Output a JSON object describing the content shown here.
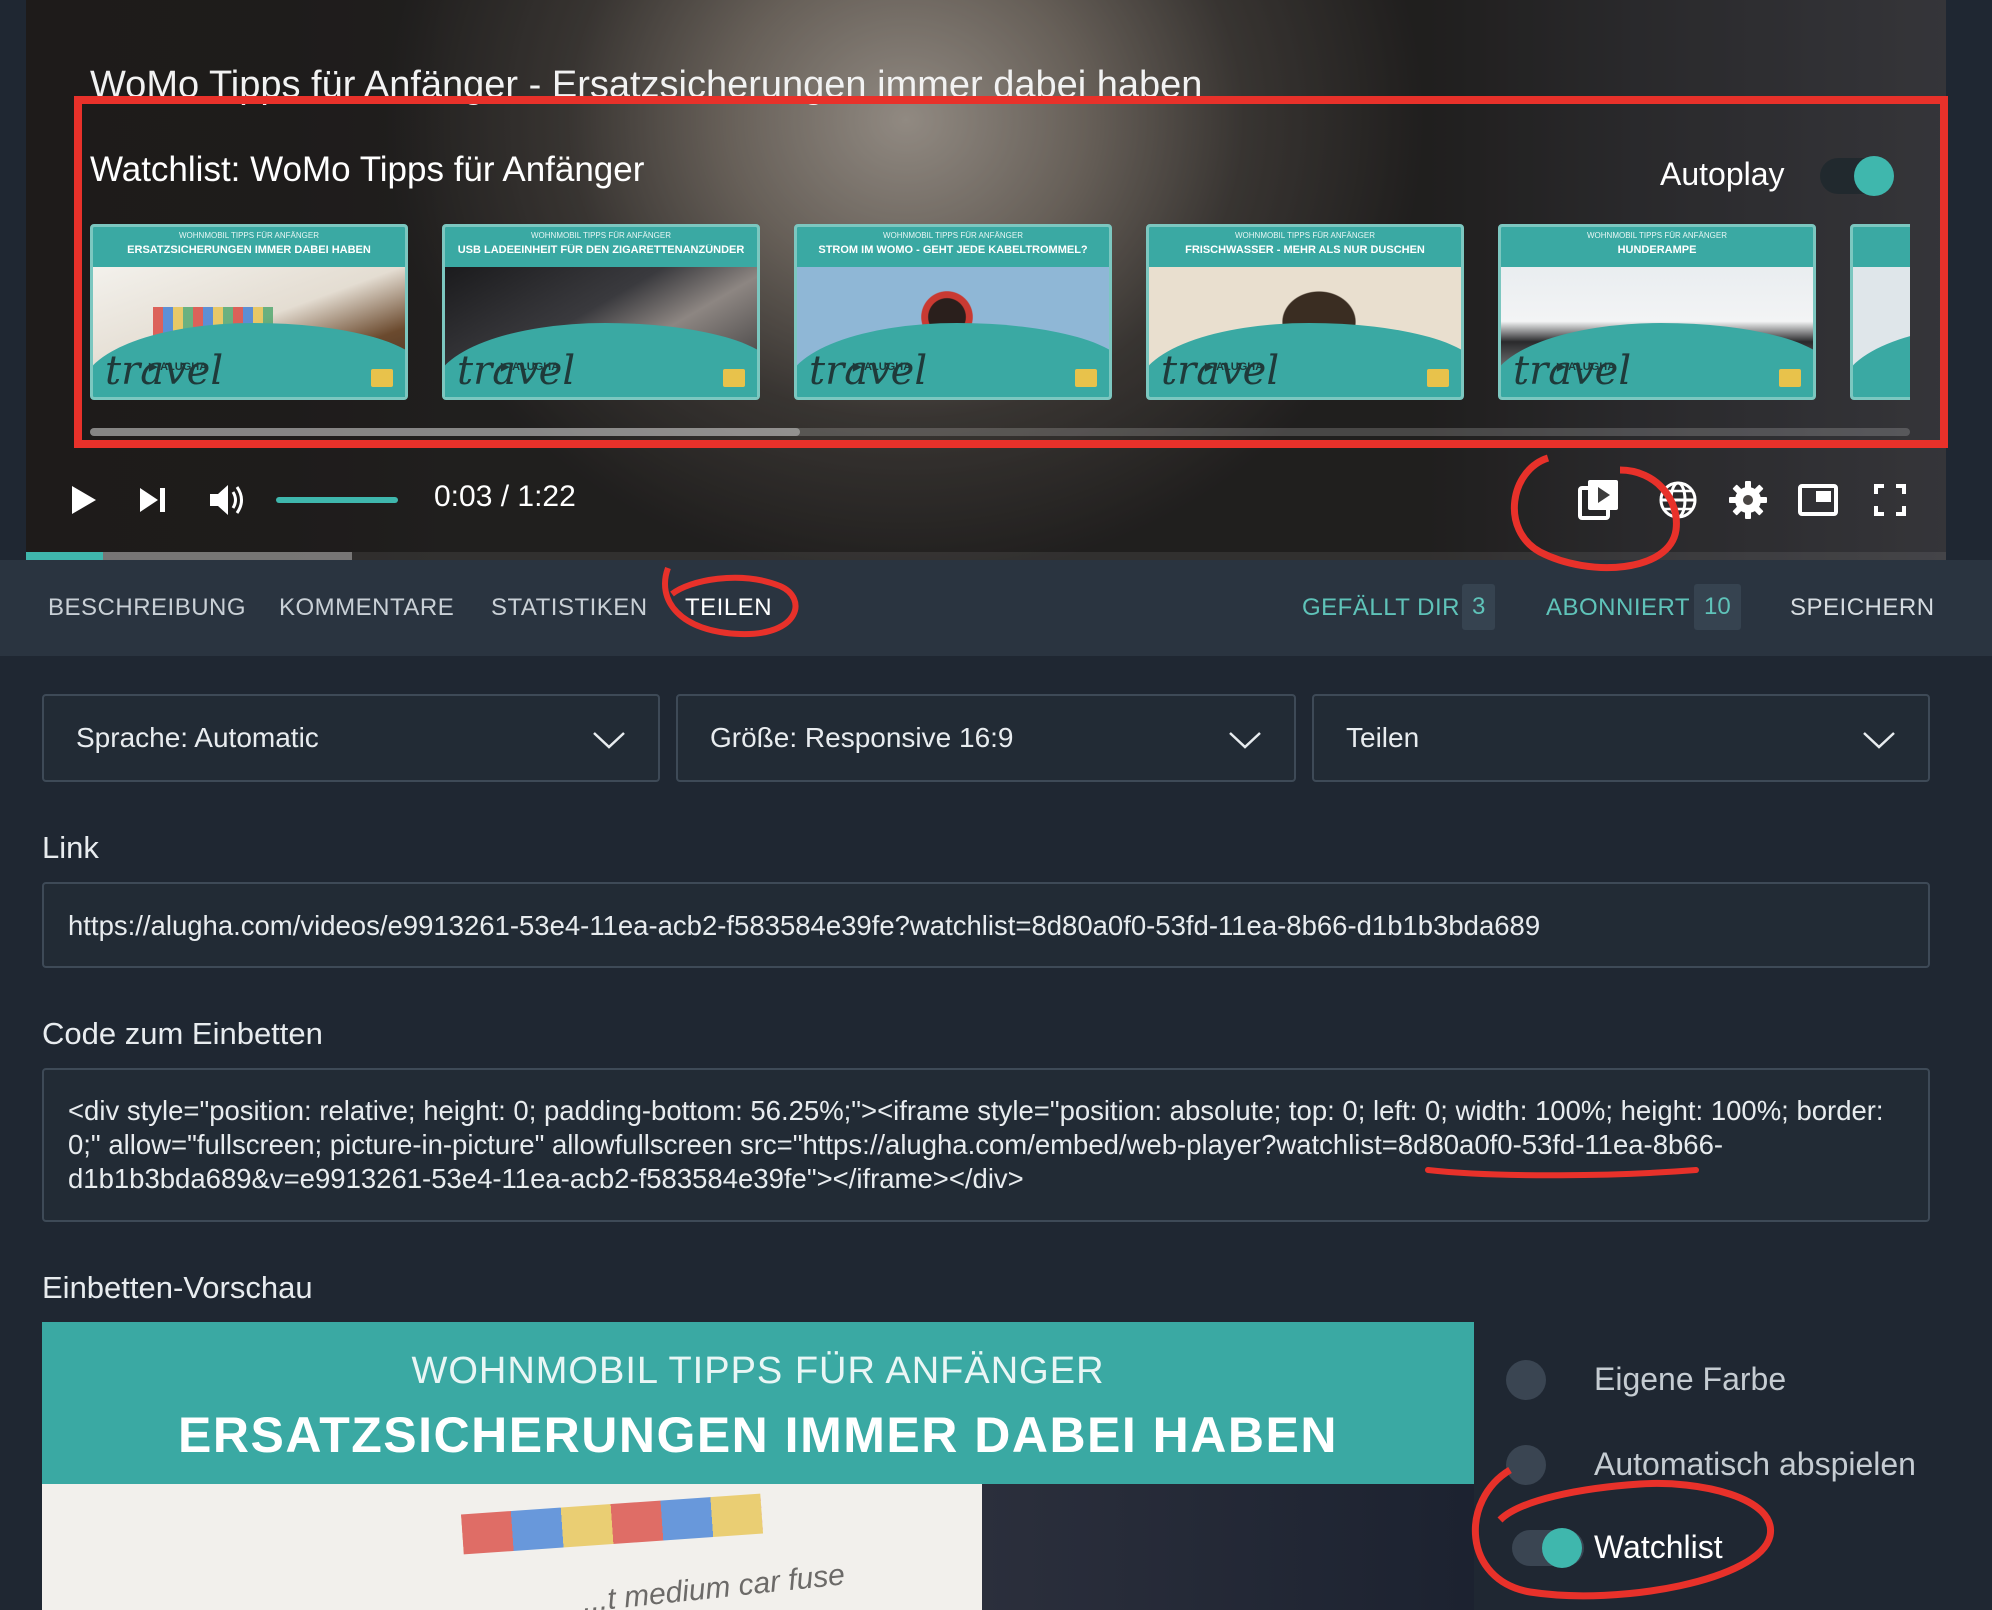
{
  "player": {
    "video_title": "WoMo Tipps für Anfänger - Ersatzsicherungen immer dabei haben",
    "watchlist_title": "Watchlist: WoMo Tipps für Anfänger",
    "autoplay_label": "Autoplay",
    "autoplay_on": true,
    "thumbnails": [
      {
        "sup": "WOHNMOBIL TIPPS FÜR ANFÄNGER",
        "caption": "ERSATZSICHERUNGEN IMMER DABEI HABEN",
        "brand": "travel",
        "brand_sup": "▶ ALUGHA"
      },
      {
        "sup": "WOHNMOBIL TIPPS FÜR ANFÄNGER",
        "caption": "USB LADEEINHEIT FÜR DEN ZIGARETTENANZÜNDER",
        "brand": "travel",
        "brand_sup": "▶ ALUGHA"
      },
      {
        "sup": "WOHNMOBIL TIPPS FÜR ANFÄNGER",
        "caption": "STROM IM WOMO - GEHT JEDE KABELTROMMEL?",
        "brand": "travel",
        "brand_sup": "▶ ALUGHA"
      },
      {
        "sup": "WOHNMOBIL TIPPS FÜR ANFÄNGER",
        "caption": "FRISCHWASSER - MEHR ALS NUR DUSCHEN",
        "brand": "travel",
        "brand_sup": "▶ ALUGHA"
      },
      {
        "sup": "WOHNMOBIL TIPPS FÜR ANFÄNGER",
        "caption": "HUNDERAMPE",
        "brand": "travel",
        "brand_sup": "▶ ALUGHA"
      }
    ],
    "time_display": "0:03 / 1:22",
    "current_time": "0:03",
    "duration": "1:22",
    "playback_progress": 0.04,
    "buffered_progress": 0.17,
    "watchlist_scroll_progress": 0.39,
    "volume_level": 1.0,
    "icons": [
      "play-icon",
      "skip-next-icon",
      "volume-icon",
      "watchlist-icon",
      "language-globe-icon",
      "settings-gear-icon",
      "miniplayer-icon",
      "fullscreen-icon"
    ]
  },
  "tabs": [
    {
      "label": "BESCHREIBUNG",
      "active": false
    },
    {
      "label": "KOMMENTARE",
      "active": false
    },
    {
      "label": "STATISTIKEN",
      "active": false
    },
    {
      "label": "TEILEN",
      "active": true
    }
  ],
  "actions": {
    "like_label": "GEFÄLLT DIR",
    "like_count": "3",
    "subscribe_label": "ABONNIERT",
    "subscribe_count": "10",
    "save_label": "SPEICHERN"
  },
  "share": {
    "language_select": "Sprache: Automatic",
    "size_select": "Größe: Responsive 16:9",
    "share_select": "Teilen",
    "link_label": "Link",
    "link_value": "https://alugha.com/videos/e9913261-53e4-11ea-acb2-f583584e39fe?watchlist=8d80a0f0-53fd-11ea-8b66-d1b1b3bda689",
    "embed_label": "Code zum Einbetten",
    "embed_code": "<div style=\"position: relative; height: 0; padding-bottom: 56.25%;\"><iframe style=\"position: absolute; top: 0; left: 0; width: 100%; height: 100%; border: 0;\" allow=\"fullscreen; picture-in-picture\" allowfullscreen src=\"https://alugha.com/embed/web-player?watchlist=8d80a0f0-53fd-11ea-8b66-d1b1b3bda689&v=e9913261-53e4-11ea-acb2-f583584e39fe\"></iframe></div>",
    "preview_label": "Einbetten-Vorschau",
    "preview_sup": "WOHNMOBIL TIPPS FÜR ANFÄNGER",
    "preview_caption": "ERSATZSICHERUNGEN IMMER DABEI HABEN",
    "preview_note": "...t medium car fuse",
    "options": [
      {
        "label": "Eigene Farbe",
        "enabled": false
      },
      {
        "label": "Automatisch abspielen",
        "enabled": false
      },
      {
        "label": "Watchlist",
        "enabled": true
      }
    ]
  },
  "colors": {
    "accent": "#3fb7ad",
    "background": "#1f2732",
    "tab_bar": "#2a3440",
    "annotation": "#e8312a"
  }
}
